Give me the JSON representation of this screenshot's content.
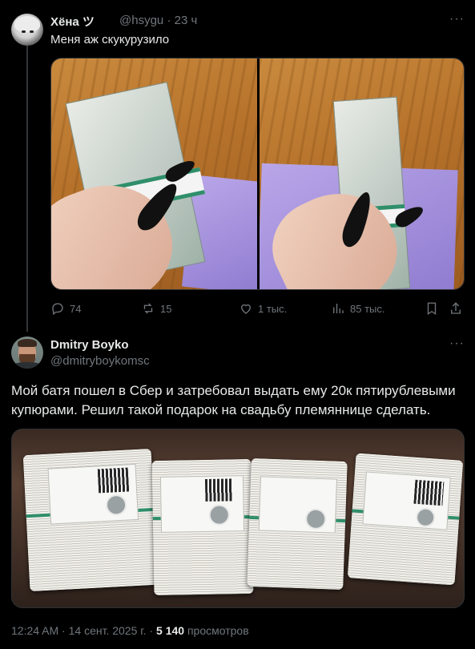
{
  "parent_tweet": {
    "author_name": "Хёна ツ",
    "author_handle": "@hsygu",
    "separator": "·",
    "time_ago": "23 ч",
    "text": "Меня аж скукурузило",
    "more_icon": "more-icon",
    "actions": {
      "replies": "74",
      "reposts": "15",
      "likes": "1 тыс.",
      "views": "85 тыс."
    }
  },
  "main_tweet": {
    "author_name": "Dmitry Boyko",
    "author_handle": "@dmitryboykomsc",
    "text_line1": "Мой батя пошел в Сбер и затребовал выдать ему 20к пятирублевыми",
    "text_line2": "купюрами. Решил такой подарок на свадьбу племяннице сделать.",
    "time": "12:24 AM",
    "dot": "·",
    "date": "14 сент. 2025 г.",
    "views_count": "5 140",
    "views_label": "просмотров",
    "more_icon": "more-icon"
  },
  "colors": {
    "background": "#000000",
    "text_primary": "#e7e9ea",
    "text_secondary": "#71767b",
    "divider": "#2f3336"
  }
}
